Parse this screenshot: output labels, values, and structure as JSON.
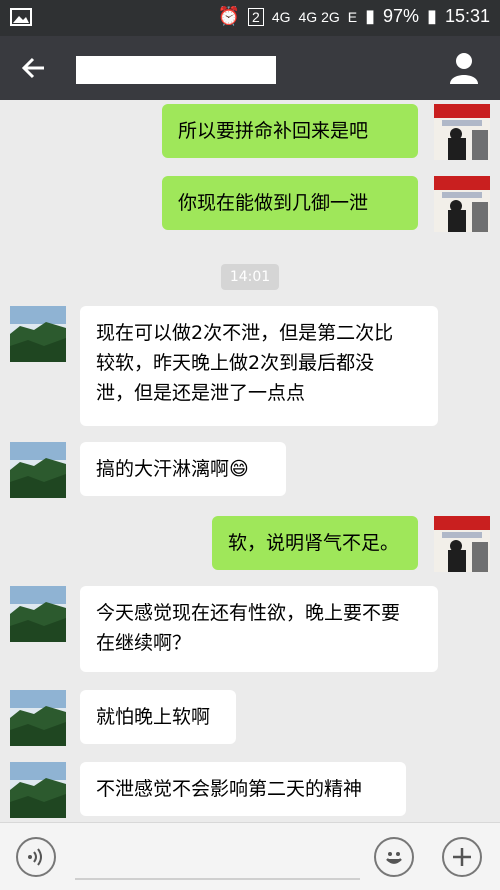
{
  "status_bar": {
    "sim_badge": "2",
    "network_1": "4G",
    "network_2": "4G 2G",
    "edge": "E",
    "battery": "97%",
    "time": "15:31"
  },
  "messages": [
    {
      "side": "out",
      "text": "所以要拼命补回来是吧"
    },
    {
      "side": "out",
      "text": "你现在能做到几御一泄"
    },
    {
      "time": "14:01"
    },
    {
      "side": "in",
      "text": "现在可以做2次不泄，但是第二次比\n较软，昨天晚上做2次到最后都没\n泄，但是还是泄了一点点"
    },
    {
      "side": "in",
      "text": "搞的大汗淋漓啊😄"
    },
    {
      "side": "out",
      "text": "软，说明肾气不足。"
    },
    {
      "side": "in",
      "text": "今天感觉现在还有性欲，晚上要不要\n在继续啊？"
    },
    {
      "side": "in",
      "text": "就怕晚上软啊"
    },
    {
      "side": "in",
      "text": "不泄感觉不会影响第二天的精神"
    }
  ],
  "colors": {
    "outgoing_bubble": "#9fe75a",
    "incoming_bubble": "#ffffff",
    "navbar": "#393a3f"
  }
}
